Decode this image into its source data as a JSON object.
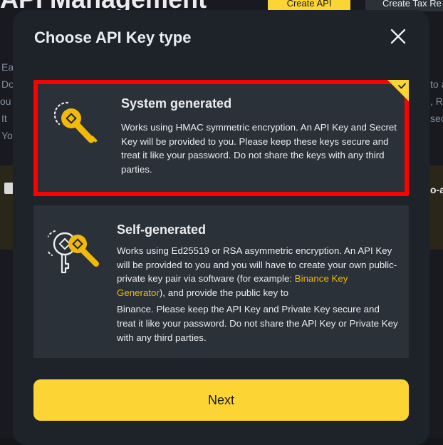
{
  "background": {
    "heading": "API Management",
    "create_api_label": "Create API",
    "create_tax_report_label": "Create Tax Re",
    "left_text_fragments": [
      "Ea",
      "Do",
      "ou s",
      "It",
      "Yo"
    ],
    "right_text_fragments": [
      "to a",
      ", R",
      "sec"
    ],
    "banner_right_text": "o-a"
  },
  "modal": {
    "title": "Choose API Key type",
    "close_icon": "close-icon",
    "options": [
      {
        "title": "System generated",
        "description": "Works using HMAC symmetric encryption. An API Key and Secret Key will be provided to you. Please keep these keys secure and treat it like your password. Do not share the keys with any third parties.",
        "icon": "system-key-icon",
        "selected": true
      },
      {
        "title": "Self-generated",
        "description_before_link": "Works using Ed25519 or RSA asymmetric encryption. An API Key will be provided to you and you will have to create your own public-private key pair via software (for example: ",
        "link_text": "Binance Key Generator",
        "description_after_link": "), and provide the public key to",
        "description_continued": "Binance. Please keep the API Key and Private Key secure and treat it like your password. Do not share the API Key or Private Key with any third parties.",
        "icon": "self-key-icon",
        "selected": false
      }
    ],
    "next_label": "Next"
  },
  "colors": {
    "accent": "#fcd535",
    "link": "#f0b90b",
    "modal_bg": "#1e2329",
    "card_bg": "#2b3139",
    "selection_outline": "#ff0000",
    "text": "#eaecef"
  }
}
